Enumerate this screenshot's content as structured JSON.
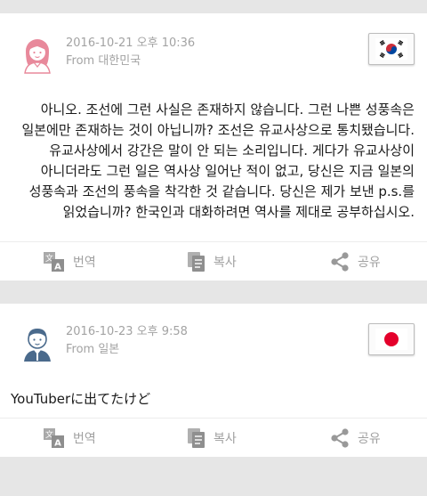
{
  "posts": [
    {
      "timestamp": "2016-10-21 오후 10:36",
      "origin": "From 대한민국",
      "avatar_icon": "female-user-avatar-icon",
      "avatar_color": "#e8899b",
      "flag_icon": "south-korea-flag-icon",
      "message": "아니오. 조선에 그런 사실은 존재하지 않습니다. 그런 나쁜 성풍속은 일본에만 존재하는 것이 아닙니까? 조선은 유교사상으로 통치됐습니다. 유교사상에서 강간은 말이 안 되는 소리입니다. 게다가 유교사상이 아니더라도 그런 일은 역사상 일어난 적이 없고, 당신은 지금 일본의 성풍속과 조선의 풍속을 착각한 것 같습니다. 당신은 제가 보낸 p.s.를 읽었습니까? 한국인과 대화하려면 역사를 제대로 공부하십시오.",
      "actions": {
        "translate": "번역",
        "copy": "복사",
        "share": "공유"
      }
    },
    {
      "timestamp": "2016-10-23 오후 9:58",
      "origin": "From 일본",
      "avatar_icon": "male-user-avatar-icon",
      "avatar_color": "#4a6a8c",
      "flag_icon": "japan-flag-icon",
      "message": "YouTuberに出てたけど",
      "actions": {
        "translate": "번역",
        "copy": "복사",
        "share": "공유"
      }
    }
  ],
  "colors": {
    "background": "#e6e6e6",
    "card": "#ffffff",
    "meta_text": "#a3a3a3",
    "action_text": "#a0a0a0",
    "japan_red": "#e4002b",
    "korea_red": "#cd2e3a",
    "korea_blue": "#0047a0"
  }
}
